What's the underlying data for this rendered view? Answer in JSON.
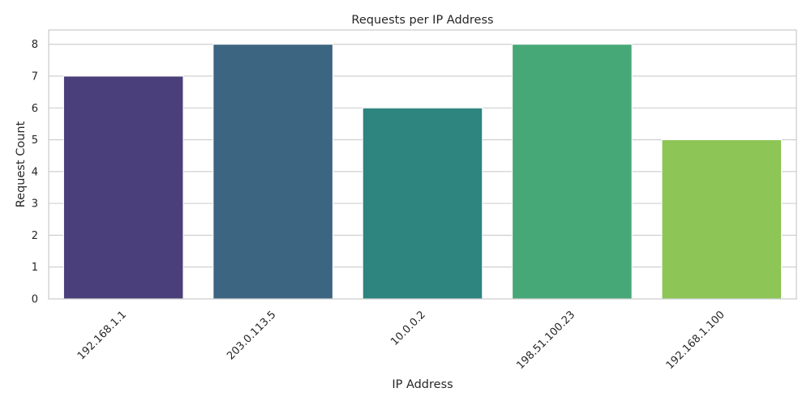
{
  "chart_data": {
    "type": "bar",
    "title": "Requests per IP Address",
    "xlabel": "IP Address",
    "ylabel": "Request Count",
    "categories": [
      "192.168.1.1",
      "203.0.113.5",
      "10.0.0.2",
      "198.51.100.23",
      "192.168.1.100"
    ],
    "values": [
      7,
      8,
      6,
      8,
      5
    ],
    "colors": [
      "#4a3f7a",
      "#3c6581",
      "#2e847e",
      "#46a876",
      "#8dc556"
    ],
    "ylim": [
      0,
      8.45
    ],
    "yticks": [
      "0",
      "1",
      "2",
      "3",
      "4",
      "5",
      "6",
      "7",
      "8"
    ],
    "grid": true,
    "grid_color": "#cccccc",
    "x_tick_rotation": 45,
    "legend": "none"
  }
}
